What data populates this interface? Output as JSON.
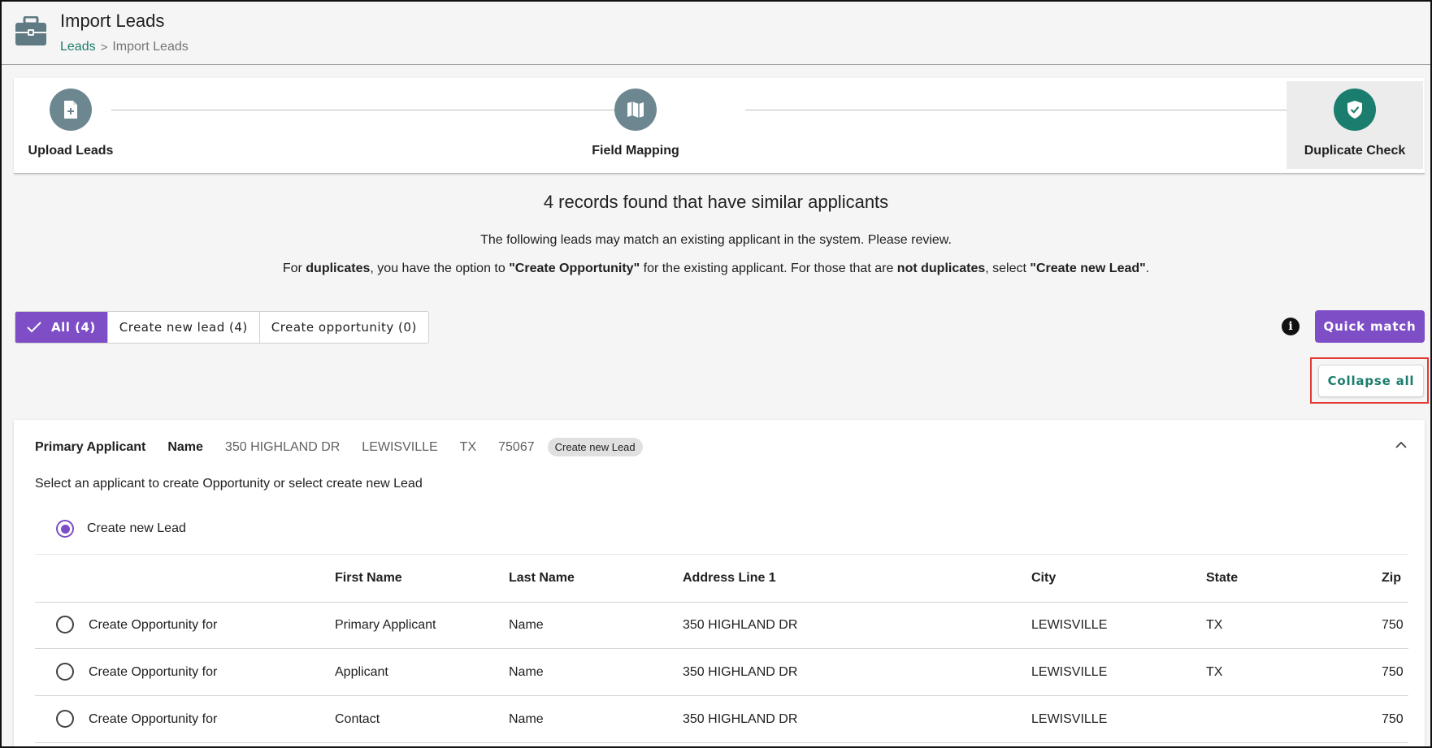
{
  "header": {
    "title": "Import Leads",
    "breadcrumb": {
      "parent": "Leads",
      "separator": ">",
      "current": "Import Leads"
    }
  },
  "stepper": {
    "steps": [
      {
        "label": "Upload Leads",
        "icon": "file-add-icon",
        "state": "done",
        "color": "#6d8790"
      },
      {
        "label": "Field Mapping",
        "icon": "map-icon",
        "state": "done",
        "color": "#6d8790"
      },
      {
        "label": "Duplicate Check",
        "icon": "shield-check-icon",
        "state": "active",
        "color": "#1b7d6d"
      }
    ]
  },
  "summary": {
    "title": "4 records found that have similar applicants",
    "line1": "The following leads may match an existing applicant in the system. Please review.",
    "line2": {
      "p1": "For ",
      "b1": "duplicates",
      "p2": ", you have the option to ",
      "b2": "\"Create Opportunity\"",
      "p3": " for the existing applicant. For those that are ",
      "b3": "not duplicates",
      "p4": ", select ",
      "b4": "\"Create new Lead\"",
      "p5": "."
    }
  },
  "filters": {
    "all": "All (4)",
    "create_new_lead": "Create new lead (4)",
    "create_opportunity": "Create opportunity (0)",
    "selected": "all"
  },
  "actions": {
    "info": "i",
    "quick_match": "Quick match",
    "collapse_all": "Collapse all"
  },
  "card": {
    "header": {
      "first": "Primary Applicant",
      "last": "Name",
      "address": "350 HIGHLAND DR",
      "city": "LEWISVILLE",
      "state": "TX",
      "zip": "75067",
      "chip": "Create new Lead"
    },
    "instruction": "Select an applicant to create Opportunity or select create new Lead",
    "new_lead_option": "Create new Lead",
    "table": {
      "columns": [
        "First Name",
        "Last Name",
        "Address Line 1",
        "City",
        "State",
        "Zip"
      ],
      "rows": [
        {
          "action": "Create Opportunity for",
          "first": "Primary Applicant",
          "last": "Name",
          "address": "350 HIGHLAND DR",
          "city": "LEWISVILLE",
          "state": "TX",
          "zip": "750"
        },
        {
          "action": "Create Opportunity for",
          "first": "Applicant",
          "last": "Name",
          "address": "350 HIGHLAND DR",
          "city": "LEWISVILLE",
          "state": "TX",
          "zip": "750"
        },
        {
          "action": "Create Opportunity for",
          "first": "Contact",
          "last": "Name",
          "address": "350 HIGHLAND DR",
          "city": "LEWISVILLE",
          "state": "",
          "zip": "750"
        }
      ]
    }
  },
  "colors": {
    "accent_purple": "#7e4ec6",
    "accent_teal": "#1b7d6d",
    "step_grey": "#6d8790",
    "highlight_red": "#e53935"
  }
}
